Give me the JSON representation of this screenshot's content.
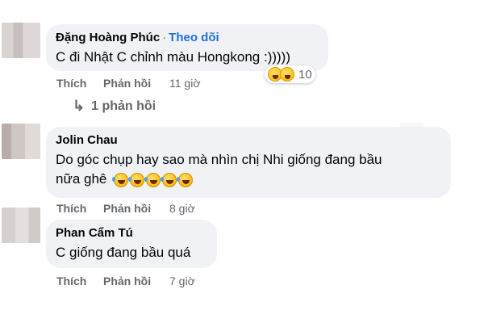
{
  "comments": [
    {
      "author": "Đặng Hoàng Phúc",
      "follow_separator": "·",
      "follow_label": "Theo dõi",
      "text": "C đi Nhật C chỉnh màu Hongkong :)))))",
      "like_label": "Thích",
      "reply_label": "Phản hồi",
      "time": "11 giờ",
      "reactions": {
        "icons": [
          "haha-icon",
          "wow-icon"
        ],
        "count": "10"
      },
      "replies_label": "1 phản hồi"
    },
    {
      "author": "Jolin Chau",
      "text_line1": "Do góc chụp hay sao mà nhìn chị Nhi giống đang bầu",
      "text_line2": "nữa ghê",
      "laugh_emoji_count": 5,
      "like_label": "Thích",
      "reply_label": "Phản hồi",
      "time": "8 giờ"
    },
    {
      "author": "Phan Cẩm Tú",
      "text": "C giống đang bầu quá",
      "like_label": "Thích",
      "reply_label": "Phản hồi",
      "time": "7 giờ"
    }
  ]
}
